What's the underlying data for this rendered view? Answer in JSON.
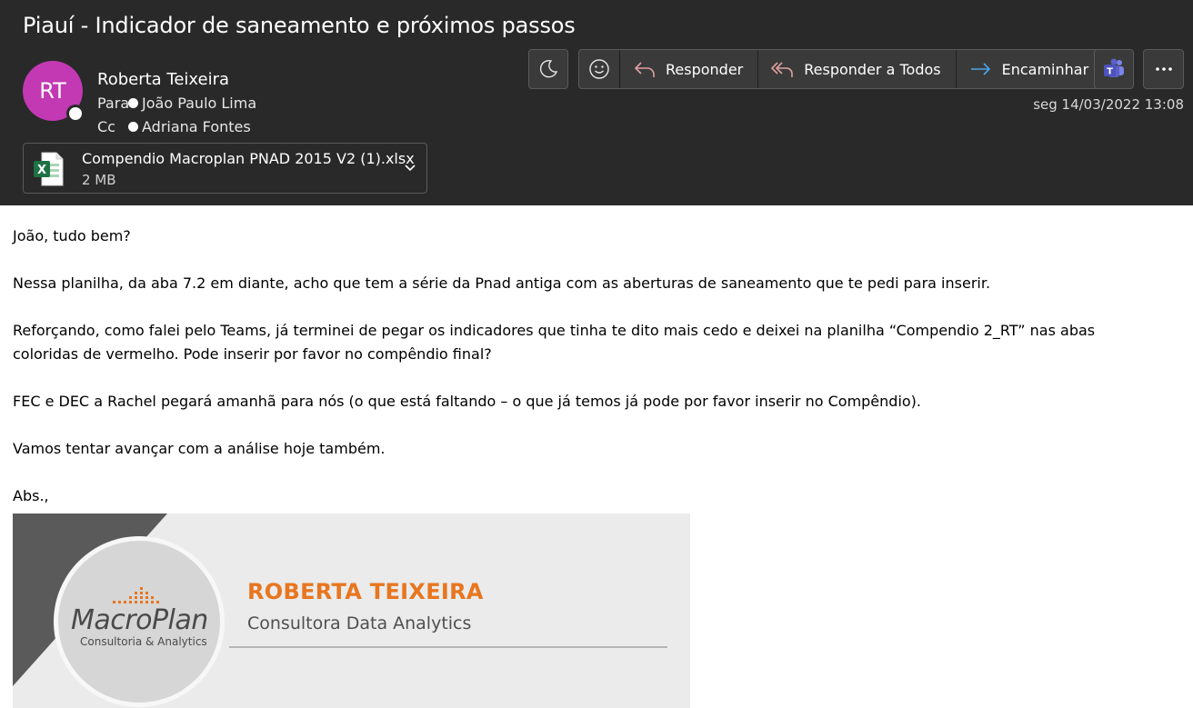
{
  "subject": "Piauí - Indicador de saneamento e próximos passos",
  "sender": {
    "initials": "RT",
    "name": "Roberta Teixeira",
    "avatar_color": "#c239b3"
  },
  "to": {
    "label": "Para",
    "name": "João Paulo Lima"
  },
  "cc": {
    "label": "Cc",
    "name": "Adriana Fontes"
  },
  "attachment": {
    "filename": "Compendio Macroplan PNAD 2015 V2 (1).xlsx",
    "size": "2 MB",
    "icon": "excel-icon"
  },
  "toolbar": {
    "night_icon": "moon-icon",
    "emoji_icon": "smiley-icon",
    "reply_label": "Responder",
    "reply_all_label": "Responder a Todos",
    "forward_label": "Encaminhar",
    "teams_icon": "teams-icon",
    "more_icon": "more-icon"
  },
  "date": "seg 14/03/2022 13:08",
  "body": {
    "p1": "João, tudo bem?",
    "p2": "Nessa planilha, da aba 7.2 em diante, acho que tem a série da Pnad antiga com as aberturas de saneamento que te pedi para inserir.",
    "p3": "Reforçando, como falei pelo Teams, já terminei de pegar os indicadores que tinha te dito mais cedo e deixei na planilha “Compendio 2_RT” nas abas coloridas de vermelho. Pode inserir por favor no compêndio final?",
    "p4": "FEC e DEC a Rachel pegará amanhã para nós (o que está faltando – o que já temos já pode por favor inserir no Compêndio).",
    "p5": "Vamos tentar avançar com a análise hoje também.",
    "p6": "Abs.,"
  },
  "signature": {
    "logo_name": "MacroPlan",
    "logo_tagline": "Consultoria & Analytics",
    "name": "ROBERTA TEIXEIRA",
    "role": "Consultora Data Analytics",
    "accent": "#e8761f"
  },
  "colors": {
    "header_bg": "#292929",
    "reply_arrow": "#e0a0a0",
    "forward_arrow": "#4aa3e8",
    "teams": "#5b5fc7"
  }
}
